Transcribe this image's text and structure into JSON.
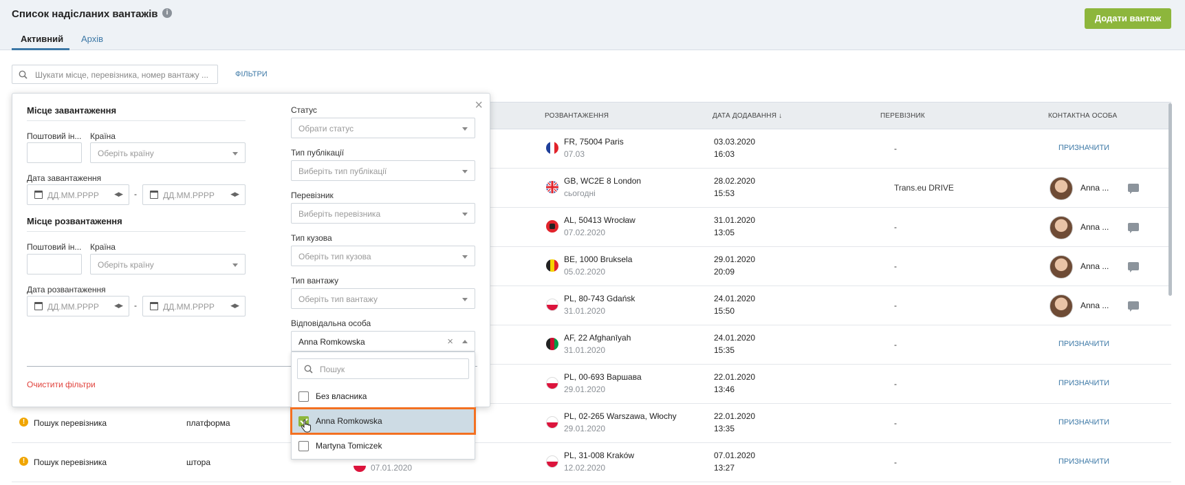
{
  "header": {
    "title": "Список надісланих вантажів",
    "tabs": [
      {
        "label": "Активний"
      },
      {
        "label": "Архів"
      }
    ],
    "add_button": "Додати вантаж"
  },
  "toolbar": {
    "search_placeholder": "Шукати місце, перевізника, номер вантажу ...",
    "filters_link": "ФІЛЬТРИ"
  },
  "table": {
    "headers": [
      "РОЗВАНТАЖЕННЯ",
      "ДАТА ДОДАВАННЯ ↓",
      "ПЕРЕВІЗНИК",
      "КОНТАКТНА ОСОБА"
    ],
    "assign_label": "ПРИЗНАЧИТИ",
    "rows": [
      {
        "unload": "FR, 75004 Paris",
        "unload_date": "07.03",
        "flag": "FR",
        "added_date": "03.03.2020",
        "added_time": "16:03",
        "carrier": "-",
        "contact": ""
      },
      {
        "unload": "GB, WC2E 8 London",
        "unload_date": "сьогодні",
        "flag": "GB",
        "added_date": "28.02.2020",
        "added_time": "15:53",
        "carrier": "Trans.eu DRIVE",
        "contact": "Anna ..."
      },
      {
        "unload": "AL, 50413 Wrocław",
        "unload_date": "07.02.2020",
        "flag": "AL",
        "added_date": "31.01.2020",
        "added_time": "13:05",
        "carrier": "-",
        "contact": "Anna ..."
      },
      {
        "unload": "BE, 1000 Bruksela",
        "unload_date": "05.02.2020",
        "flag": "BE",
        "added_date": "29.01.2020",
        "added_time": "20:09",
        "carrier": "-",
        "contact": "Anna ..."
      },
      {
        "unload": "PL, 80-743 Gdańsk",
        "unload_date": "31.01.2020",
        "flag": "PL",
        "added_date": "24.01.2020",
        "added_time": "15:50",
        "carrier": "-",
        "contact": "Anna ..."
      },
      {
        "unload": "AF, 22 Afghanīyah",
        "unload_date": "31.01.2020",
        "flag": "AF",
        "added_date": "24.01.2020",
        "added_time": "15:35",
        "carrier": "-",
        "contact": ""
      },
      {
        "unload": "PL, 00-693 Варшава",
        "unload_date": "29.01.2020",
        "flag": "PL",
        "added_date": "22.01.2020",
        "added_time": "13:46",
        "carrier": "-",
        "contact": ""
      },
      {
        "unload": "PL, 02-265 Warszawa, Włochy",
        "unload_date": "29.01.2020",
        "flag": "PL",
        "added_date": "22.01.2020",
        "added_time": "13:35",
        "carrier": "-",
        "contact": "",
        "status": "Пошук перевізника",
        "body": "платформа"
      },
      {
        "unload": "PL, 31-008 Kraków",
        "unload_date": "12.02.2020",
        "flag": "PL",
        "added_date": "07.01.2020",
        "added_time": "13:27",
        "carrier": "-",
        "contact": "",
        "status": "Пошук перевізника",
        "body": "штора",
        "load_date": "07.01.2020"
      }
    ]
  },
  "filter_panel": {
    "loading_section": "Місце завантаження",
    "postal_label": "Поштовий ін...",
    "country_label": "Країна",
    "country_placeholder": "Оберіть країну",
    "loading_date_label": "Дата завантаження",
    "date_placeholder": "ДД.ММ.РРРР",
    "unloading_section": "Місце розвантаження",
    "unloading_date_label": "Дата розвантаження",
    "status_label": "Статус",
    "status_placeholder": "Обрати статус",
    "publication_label": "Тип публікації",
    "publication_placeholder": "Виберіть тип публікації",
    "carrier_label": "Перевізник",
    "carrier_placeholder": "Виберіть перевізника",
    "body_label": "Тип кузова",
    "body_placeholder": "Оберіть тип кузова",
    "cargo_label": "Тип вантажу",
    "cargo_placeholder": "Оберіть тип вантажу",
    "responsible_label": "Відповідальна особа",
    "responsible_value": "Anna Romkowska",
    "clear_filters": "Очистити фільтри"
  },
  "dropdown": {
    "search_placeholder": "Пошук",
    "options": [
      {
        "label": "Без власника",
        "checked": false
      },
      {
        "label": "Anna Romkowska",
        "checked": true
      },
      {
        "label": "Martyna Tomiczek",
        "checked": false
      }
    ]
  }
}
